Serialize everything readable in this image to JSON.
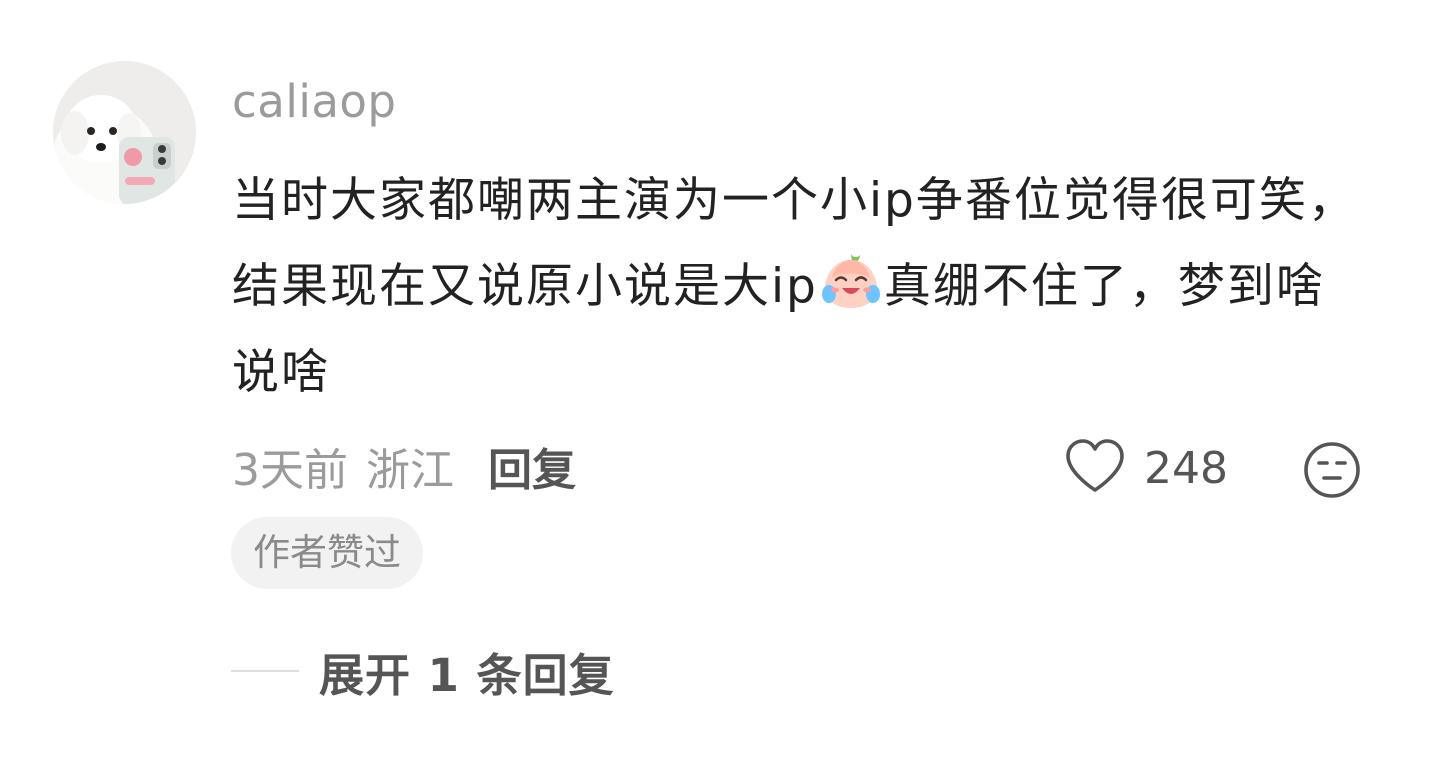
{
  "comment": {
    "username": "caliaop",
    "text_part1": "当时大家都嘲两主演为一个小ip争番位觉得很可笑，结果现在又说原小说是大ip",
    "emoji": "crying-laughing-peach-emoji",
    "text_part2": "真绷不住了，梦到啥说啥",
    "time": "3天前",
    "location": "浙江",
    "reply_label": "回复",
    "like_count": "248",
    "author_badge": "作者赞过",
    "expand_label": "展开 1 条回复"
  },
  "icons": {
    "like": "heart-outline-icon",
    "dislike": "meh-face-icon"
  },
  "colors": {
    "username": "#9b9b9b",
    "body_text": "#222222",
    "meta_text": "#9b9b9b",
    "action_text": "#555555",
    "badge_bg": "#f2f2f2"
  }
}
